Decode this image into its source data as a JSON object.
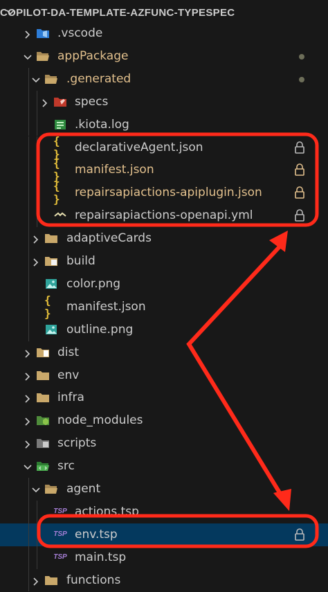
{
  "explorer": {
    "title": "COPILOT-DA-TEMPLATE-AZFUNC-TYPESPEC"
  },
  "colors": {
    "folder": "#c9a86a",
    "annotation": "#ff2a1a",
    "modified": "#e2c08d",
    "text": "#cccccc",
    "selection": "#04395e"
  },
  "tree": [
    {
      "label": ".vscode",
      "icon": "vscode-folder-icon",
      "chevron": "right"
    },
    {
      "label": "appPackage",
      "icon": "folder-open-icon",
      "chevron": "down",
      "modified": true
    },
    {
      "label": ".generated",
      "icon": "folder-open-icon",
      "chevron": "down",
      "modified": true
    },
    {
      "label": "specs",
      "icon": "specs-folder-icon",
      "chevron": "right"
    },
    {
      "label": ".kiota.log",
      "icon": "log-file-icon"
    },
    {
      "label": "declarativeAgent.json",
      "icon": "json-icon",
      "locked": true
    },
    {
      "label": "manifest.json",
      "icon": "json-icon",
      "locked": true,
      "modified": true
    },
    {
      "label": "repairsapiactions-apiplugin.json",
      "icon": "json-icon",
      "locked": true,
      "modified": true
    },
    {
      "label": "repairsapiactions-openapi.yml",
      "icon": "yaml-icon",
      "locked": true
    },
    {
      "label": "adaptiveCards",
      "icon": "folder-icon",
      "chevron": "right"
    },
    {
      "label": "build",
      "icon": "build-folder-icon",
      "chevron": "right"
    },
    {
      "label": "color.png",
      "icon": "image-icon"
    },
    {
      "label": "manifest.json",
      "icon": "json-icon"
    },
    {
      "label": "outline.png",
      "icon": "image-icon"
    },
    {
      "label": "dist",
      "icon": "dist-folder-icon",
      "chevron": "right"
    },
    {
      "label": "env",
      "icon": "folder-icon",
      "chevron": "right"
    },
    {
      "label": "infra",
      "icon": "folder-icon",
      "chevron": "right"
    },
    {
      "label": "node_modules",
      "icon": "node-folder-icon",
      "chevron": "right"
    },
    {
      "label": "scripts",
      "icon": "scripts-folder-icon",
      "chevron": "right"
    },
    {
      "label": "src",
      "icon": "src-folder-icon",
      "chevron": "down"
    },
    {
      "label": "agent",
      "icon": "folder-open-icon",
      "chevron": "down"
    },
    {
      "label": "actions.tsp",
      "icon": "tsp-icon",
      "icon_text": "TSP"
    },
    {
      "label": "env.tsp",
      "icon": "tsp-icon",
      "icon_text": "TSP",
      "locked": true,
      "selected": true
    },
    {
      "label": "main.tsp",
      "icon": "tsp-icon",
      "icon_text": "TSP"
    },
    {
      "label": "functions",
      "icon": "folder-icon",
      "chevron": "right"
    }
  ]
}
